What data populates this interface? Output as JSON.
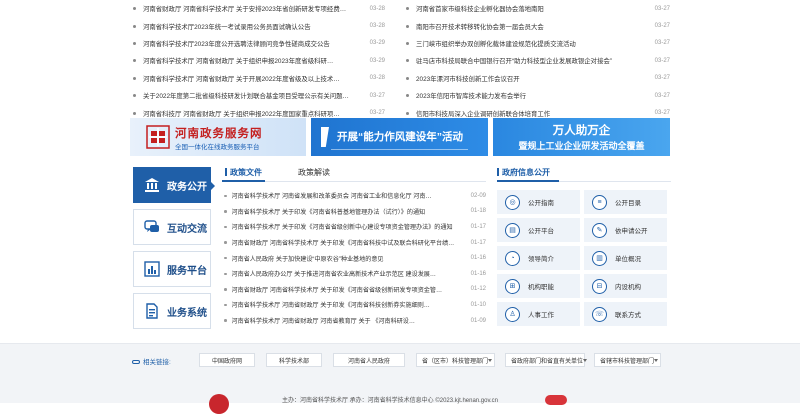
{
  "news_left": [
    {
      "title": "河南省财政厅 河南省科学技术厅 关于安排2023年省创新研发专项经费…",
      "date": "03-28"
    },
    {
      "title": "河南省科学技术厅2023年统一考试录用公务员面试确认公告",
      "date": "03-28"
    },
    {
      "title": "河南省科学技术厅2023年度公开选聘法律顾问竞争性磋商成交公告",
      "date": "03-29"
    },
    {
      "title": "河南省科学技术厅 河南省财政厅 关于组织申报2023年度省级科研…",
      "date": "03-29"
    },
    {
      "title": "河南省科学技术厅 河南省财政厅 关于开展2022年度省级及以上技术…",
      "date": "03-28"
    },
    {
      "title": "关于2022年度第二批省级科技研发计划联合基金项目受理公示有关问题的…",
      "date": "03-27"
    },
    {
      "title": "河南省科技厅 河南省财政厅 关于组织申报2022年度国家重点科研项…",
      "date": "03-27"
    }
  ],
  "news_right": [
    {
      "title": "河南省首家市级科技企业孵化器协会落地南阳",
      "date": "03-27"
    },
    {
      "title": "南阳市召开技术转移转化协会第一届会员大会",
      "date": "03-27"
    },
    {
      "title": "三门峡市组织举办双创孵化载体建设规范化提质交流活动",
      "date": "03-27"
    },
    {
      "title": "驻马店市科技局联合中国银行召开“助力科技型企业发展政银企对接会”",
      "date": "03-27"
    },
    {
      "title": "2023年漯河市科技创新工作会议召开",
      "date": "03-27"
    },
    {
      "title": "2023年信阳市智库技术能力发布会举行",
      "date": "03-27"
    },
    {
      "title": "信阳市科技局深入企业调研创新联合体培育工作",
      "date": "03-27"
    }
  ],
  "banners": {
    "b1_name": "河南政务服务网",
    "b1_sub": "全国一体化在线政务服务平台",
    "b2_text": "开展“能力作风建设年”活动",
    "b3_line1": "万人助万企",
    "b3_line2": "暨规上工业企业研发活动全覆盖"
  },
  "left_nav": [
    {
      "label": "政务公开",
      "icon": "building-icon",
      "active": true
    },
    {
      "label": "互动交流",
      "icon": "chat-icon",
      "active": false
    },
    {
      "label": "服务平台",
      "icon": "chart-icon",
      "active": false
    },
    {
      "label": "业务系统",
      "icon": "document-icon",
      "active": false
    }
  ],
  "policy": {
    "tab_active": "政策文件",
    "tab_other": "政策解读",
    "items": [
      {
        "title": "河南省科学技术厅 河南省发展和改革委员会 河南省工业和信息化厅 河南…",
        "date": "02-09"
      },
      {
        "title": "河南省科学技术厅 关于印发《河南省科普基地管理办法（试行）》的通知",
        "date": "01-18"
      },
      {
        "title": "河南省科学技术厅 关于印发《河南省省级创新中心建设专项资金管理办法》的通知",
        "date": "01-17"
      },
      {
        "title": "河南省财政厅 河南省科学技术厅 关于印发《河南省科技中试及联合科研化平台绩效考核奖补实施…",
        "date": "01-17"
      },
      {
        "title": "河南省人民政府 关于加快建设“中原农谷”种业基地的意见",
        "date": "01-16"
      },
      {
        "title": "河南省人民政府办公厅 关于推进河南省农业高新技术产业示范区 建设发展…",
        "date": "01-16"
      },
      {
        "title": "河南省财政厅 河南省科学技术厅 关于印发《河南省省级创新研发专项资金管…",
        "date": "01-12"
      },
      {
        "title": "河南省科学技术厅 河南省财政厅 关于印发《河南省科技创新券实施细则…",
        "date": "01-10"
      },
      {
        "title": "河南省科学技术厅 河南省财政厅 河南省教育厅 关于 《河南科研设…",
        "date": "01-09"
      }
    ]
  },
  "gov_info": {
    "title": "政府信息公开",
    "items": [
      {
        "label": "公开指南",
        "icon": "compass-icon",
        "glyph": "◎"
      },
      {
        "label": "公开目录",
        "icon": "list-icon",
        "glyph": "≡"
      },
      {
        "label": "公开平台",
        "icon": "clipboard-icon",
        "glyph": "▤"
      },
      {
        "label": "依申请公开",
        "icon": "edit-icon",
        "glyph": "✎"
      },
      {
        "label": "领导简介",
        "icon": "user-icon",
        "glyph": "◔"
      },
      {
        "label": "单位概况",
        "icon": "building-icon",
        "glyph": "▥"
      },
      {
        "label": "机构职能",
        "icon": "org-icon",
        "glyph": "⊞"
      },
      {
        "label": "内设机构",
        "icon": "sitemap-icon",
        "glyph": "⊟"
      },
      {
        "label": "人事工作",
        "icon": "person-icon",
        "glyph": "♙"
      },
      {
        "label": "联系方式",
        "icon": "phone-icon",
        "glyph": "☏"
      }
    ]
  },
  "links": {
    "label": "相关链接:",
    "buttons": [
      "中国政府网",
      "科学技术部",
      "河南省人民政府"
    ],
    "selects": [
      "省（区市）科技管理部门",
      "省政府部门和省直有关单位",
      "省辖市科技管理部门"
    ]
  },
  "footer": {
    "text": "主办：河南省科学技术厅   承办：河南省科学技术信息中心   ©2023.kjt.henan.gov.cn"
  }
}
